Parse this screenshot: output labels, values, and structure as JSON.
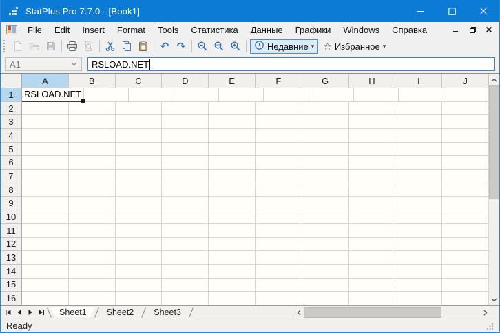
{
  "window": {
    "title": "StatPlus Pro 7.7.0  - [Book1]",
    "controls": [
      "minimize",
      "maximize",
      "close"
    ]
  },
  "menu": {
    "items": [
      "File",
      "Edit",
      "Insert",
      "Format",
      "Tools",
      "Статистика",
      "Данные",
      "Графики",
      "Windows",
      "Справка"
    ],
    "mdi_controls": [
      "minimize",
      "restore",
      "close"
    ]
  },
  "toolbar": {
    "groups": [
      [
        {
          "name": "new-document",
          "icon": "new-document-icon",
          "disabled": true
        },
        {
          "name": "open",
          "icon": "open-folder-icon",
          "disabled": true
        },
        {
          "name": "save",
          "icon": "save-floppy-icon",
          "disabled": true
        }
      ],
      [
        {
          "name": "print",
          "icon": "printer-icon",
          "disabled": false
        },
        {
          "name": "print-preview",
          "icon": "print-preview-icon",
          "disabled": true
        }
      ],
      [
        {
          "name": "cut",
          "icon": "scissors-icon",
          "disabled": false
        },
        {
          "name": "copy",
          "icon": "copy-icon",
          "disabled": false
        },
        {
          "name": "paste",
          "icon": "clipboard-icon",
          "disabled": false
        }
      ],
      [
        {
          "name": "undo",
          "icon": "undo-arrow-icon",
          "disabled": false
        },
        {
          "name": "redo",
          "icon": "redo-arrow-icon",
          "disabled": false
        }
      ],
      [
        {
          "name": "zoom-out",
          "icon": "magnifier-minus-icon",
          "disabled": false
        },
        {
          "name": "zoom-100",
          "icon": "magnifier-100-icon",
          "disabled": false
        },
        {
          "name": "zoom-in",
          "icon": "magnifier-plus-icon",
          "disabled": false
        }
      ]
    ],
    "recent_button": {
      "label": "Недавние",
      "icon": "clock-icon"
    },
    "favorites_button": {
      "label": "Избранное",
      "icon": "star-icon"
    }
  },
  "formula_bar": {
    "name_box_value": "A1",
    "formula_value": "RSLOAD.NET"
  },
  "grid": {
    "columns": [
      "A",
      "B",
      "C",
      "D",
      "E",
      "F",
      "G",
      "H",
      "I",
      "J"
    ],
    "rows": [
      "1",
      "2",
      "3",
      "4",
      "5",
      "6",
      "7",
      "8",
      "9",
      "10",
      "11",
      "12",
      "13",
      "14",
      "15",
      "16"
    ],
    "cells": {
      "A1": "RSLOAD.NET"
    },
    "selection": {
      "active_cell": "A1",
      "column": "A",
      "row": "1"
    }
  },
  "sheet_tabs": {
    "tabs": [
      "Sheet1",
      "Sheet2",
      "Sheet3"
    ],
    "active": "Sheet1"
  },
  "status_bar": {
    "text": "Ready"
  },
  "colors": {
    "titlebar": "#0c7bd6",
    "accent": "#2b88d8",
    "selection_header": "#b5d7ef",
    "recent_button_border": "#4a90d9",
    "recent_button_bg": "#dcebfa"
  }
}
